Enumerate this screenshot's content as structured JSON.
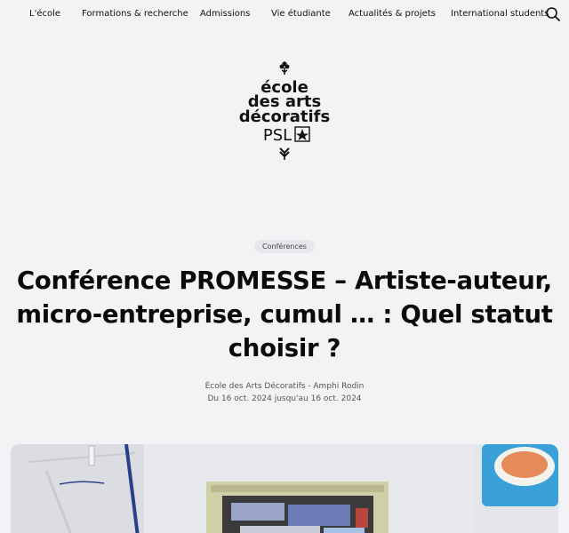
{
  "nav": {
    "items": [
      "L'école",
      "Formations & recherche",
      "Admissions",
      "Vie étudiante",
      "Actualités & projets",
      "International students"
    ]
  },
  "logo": {
    "lines": [
      "école",
      "des arts",
      "décoratifs"
    ],
    "psl": "PSL"
  },
  "article": {
    "tag": "Conférences",
    "title_lines": [
      "Conférence PROMESSE – Artiste-auteur,",
      "micro-entreprise, cumul … : Quel statut",
      "choisir ?"
    ],
    "location": "École des Arts Décoratifs - Amphi Rodin",
    "dates": "Du 16 oct. 2024 jusqu'au 16 oct. 2024"
  }
}
